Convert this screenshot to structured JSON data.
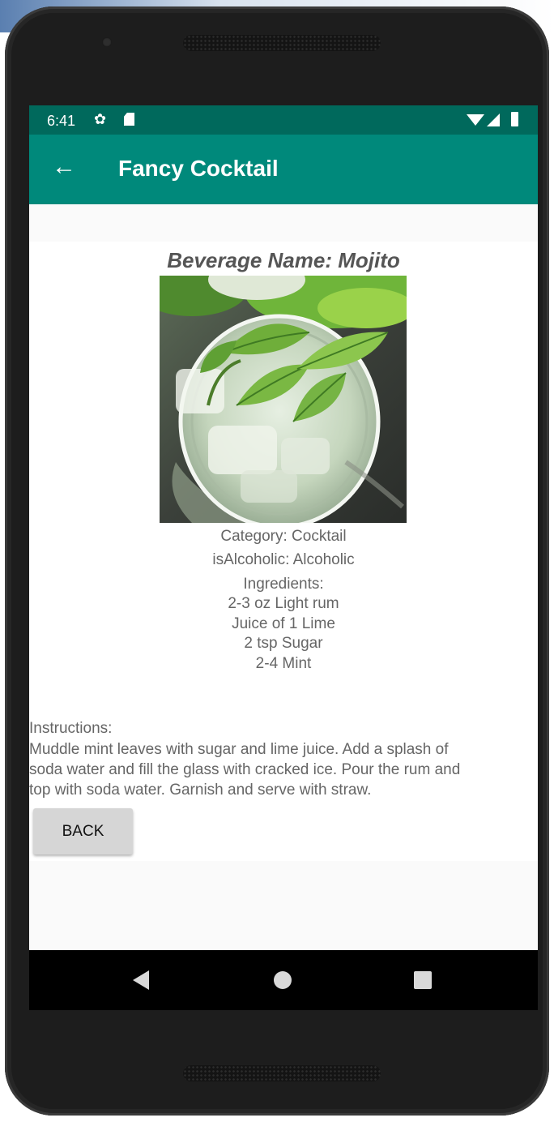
{
  "status_bar": {
    "time": "6:41"
  },
  "app_bar": {
    "title": "Fancy Cocktail"
  },
  "drink": {
    "name_line": "Beverage Name: Mojito",
    "category_line": "Category: Cocktail",
    "alcoholic_line": "isAlcoholic: Alcoholic",
    "ingredients_heading": "Ingredients:",
    "ingredients": [
      "2-3 oz Light rum",
      "Juice of 1 Lime",
      "2 tsp Sugar",
      "2-4 Mint"
    ],
    "instructions_heading": "Instructions:",
    "instructions_lines": [
      "Muddle mint leaves with sugar and lime juice. Add a splash of",
      "soda water and fill the glass with cracked ice. Pour the rum and",
      "top with soda water. Garnish and serve with straw."
    ]
  },
  "buttons": {
    "back_label": "BACK"
  },
  "colors": {
    "status_bar": "#00695c",
    "app_bar": "#00897b",
    "text_gray": "#666666"
  }
}
